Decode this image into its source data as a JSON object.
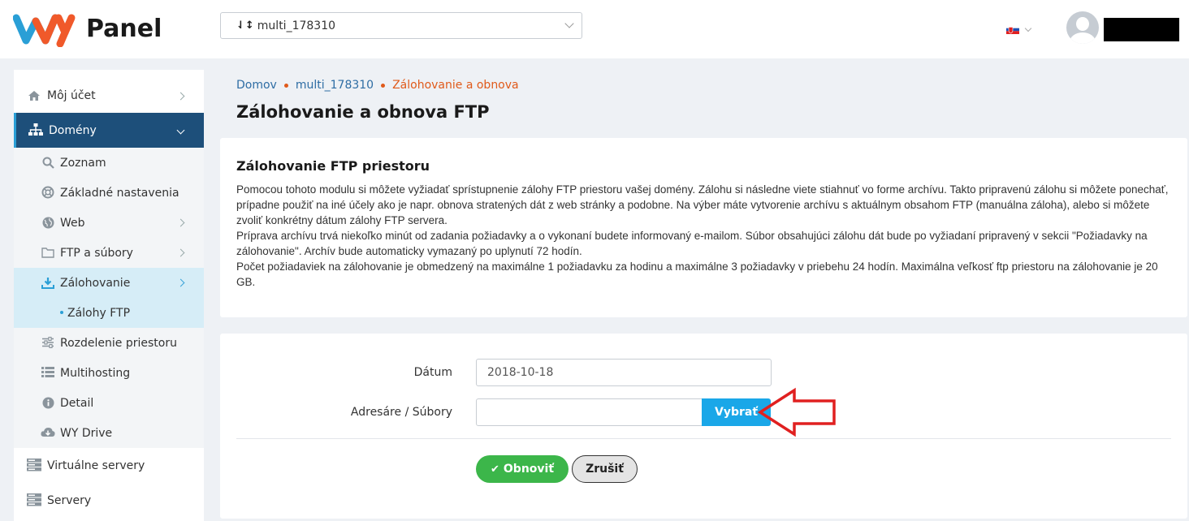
{
  "header": {
    "logo_text": "Panel",
    "domain_select": {
      "value": "multi_178310",
      "sort_icon": "sort-numeric-down-icon"
    },
    "language": "sk",
    "avatar": "user-avatar-icon"
  },
  "sidebar": {
    "my_account": "Môj účet",
    "domains": "Domény",
    "sub": {
      "list": "Zoznam",
      "basic_settings": "Základné nastavenia",
      "web": "Web",
      "ftp_files": "FTP a súbory",
      "backup": "Zálohovanie",
      "ftp_backups": "Zálohy FTP",
      "space_split": "Rozdelenie priestoru",
      "multihosting": "Multihosting",
      "detail": "Detail",
      "wy_drive": "WY Drive"
    },
    "virtual_servers": "Virtuálne servery",
    "servers": "Servery"
  },
  "breadcrumb": {
    "home": "Domov",
    "domain": "multi_178310",
    "current": "Zálohovanie a obnova"
  },
  "page_title": "Zálohovanie a obnova FTP",
  "info_card": {
    "title": "Zálohovanie FTP priestoru",
    "line1": "Pomocou tohoto modulu si môžete vyžiadať sprístupnenie zálohy FTP priestoru vašej domény. Zálohu si následne viete stiahnuť vo forme archívu. Takto pripravenú zálohu si môžete ponechať, prípadne použiť na iné účely ako je napr. obnova stratených dát z web stránky a podobne. Na výber máte vytvorenie archívu s aktuálnym obsahom FTP (manuálna záloha), alebo si môžete zvoliť konkrétny dátum zálohy FTP servera.",
    "line2": "Príprava archívu trvá niekoľko minút od zadania požiadavky a o vykonaní budete informovaný e-mailom. Súbor obsahujúci zálohu dát bude po vyžiadaní pripravený v sekcii \"Požiadavky na zálohovanie\". Archív bude automaticky vymazaný po uplynutí 72 hodín.",
    "line3": "Počet požiadaviek na zálohovanie je obmedzený na maximálne 1 požiadavku za hodinu a maximálne 3 požiadavky v priebehu 24 hodín. Maximálna veľkosť ftp priestoru na zálohovanie je 20 GB."
  },
  "form": {
    "date_label": "Dátum",
    "date_value": "2018-10-18",
    "dirs_label": "Adresáre / Súbory",
    "dirs_value": "",
    "choose_button": "Vybrať",
    "restore_button": "Obnoviť",
    "cancel_button": "Zrušiť"
  },
  "colors": {
    "accent_blue": "#1aa7e8",
    "nav_active": "#1d4f7a",
    "success": "#3cb64a",
    "breadcrumb_current": "#e05a1a",
    "annotation_arrow": "#e02020"
  }
}
